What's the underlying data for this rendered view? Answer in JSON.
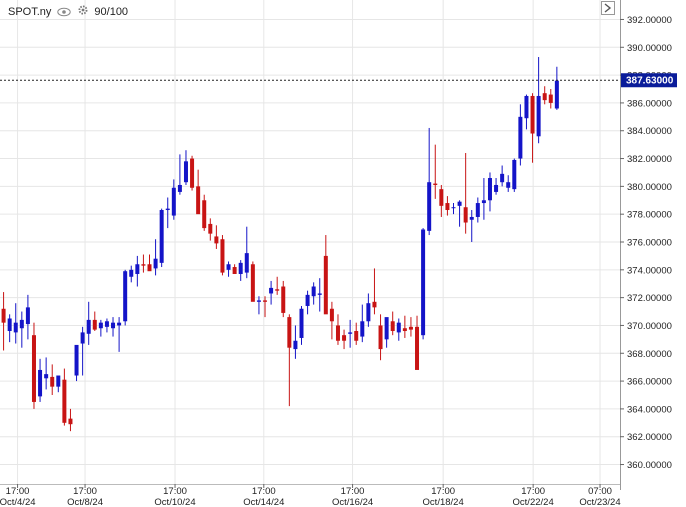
{
  "header": {
    "symbol": "SPOT.ny",
    "visibility_icon": "eye-icon",
    "settings_icon": "gear-icon",
    "count_label": "90/100"
  },
  "price_tag": "387.63000",
  "colors": {
    "up": "#1414c8",
    "down": "#c81414",
    "grid": "#e6e6e6",
    "tag_bg": "#0a1c9a"
  },
  "chart_data": {
    "type": "candlestick",
    "ylim": [
      358.6,
      393.4
    ],
    "y_ticks": [
      "392.00000",
      "390.00000",
      "388.00000",
      "386.00000",
      "384.00000",
      "382.00000",
      "380.00000",
      "378.00000",
      "376.00000",
      "374.00000",
      "372.00000",
      "370.00000",
      "368.00000",
      "366.00000",
      "364.00000",
      "362.00000",
      "360.00000"
    ],
    "y_tick_values": [
      392,
      390,
      388,
      386,
      384,
      382,
      380,
      378,
      376,
      374,
      372,
      370,
      368,
      366,
      364,
      362,
      360
    ],
    "last_price": 387.63,
    "x_ticks": [
      {
        "line1": "17:00",
        "line2": "Oct/4/24",
        "i": 3.3
      },
      {
        "line1": "17:00",
        "line2": "Oct/8/24",
        "i": 14.4
      },
      {
        "line1": "17:00",
        "line2": "Oct/10/24",
        "i": 29.2
      },
      {
        "line1": "17:00",
        "line2": "Oct/14/24",
        "i": 43.8
      },
      {
        "line1": "17:00",
        "line2": "Oct/16/24",
        "i": 58.4
      },
      {
        "line1": "17:00",
        "line2": "Oct/18/24",
        "i": 73.3
      },
      {
        "line1": "17:00",
        "line2": "Oct/22/24",
        "i": 88.1
      },
      {
        "line1": "07:00",
        "line2": "Oct/23/24",
        "i": 99.1
      }
    ],
    "candles": [
      {
        "o": 373.8,
        "h": 373.8,
        "l": 368.5,
        "c": 370.3
      },
      {
        "o": 371.2,
        "h": 372.4,
        "l": 368.2,
        "c": 370.2
      },
      {
        "o": 369.6,
        "h": 370.8,
        "l": 368.8,
        "c": 370.5
      },
      {
        "o": 369.5,
        "h": 371.6,
        "l": 368.7,
        "c": 370.2
      },
      {
        "o": 369.8,
        "h": 371.0,
        "l": 368.4,
        "c": 370.4
      },
      {
        "o": 370.1,
        "h": 372.2,
        "l": 369.0,
        "c": 371.3
      },
      {
        "o": 369.3,
        "h": 370.2,
        "l": 364.0,
        "c": 364.5
      },
      {
        "o": 364.9,
        "h": 367.6,
        "l": 364.5,
        "c": 366.8
      },
      {
        "o": 366.2,
        "h": 367.7,
        "l": 365.4,
        "c": 366.5
      },
      {
        "o": 366.3,
        "h": 367.2,
        "l": 365.0,
        "c": 365.6
      },
      {
        "o": 365.6,
        "h": 366.2,
        "l": 365.2,
        "c": 366.4
      },
      {
        "o": 366.1,
        "h": 366.9,
        "l": 362.8,
        "c": 363.0
      },
      {
        "o": 363.3,
        "h": 364.0,
        "l": 362.4,
        "c": 362.9
      },
      {
        "o": 366.4,
        "h": 368.4,
        "l": 366.0,
        "c": 368.6
      },
      {
        "o": 368.7,
        "h": 369.9,
        "l": 366.4,
        "c": 369.5
      },
      {
        "o": 369.4,
        "h": 371.7,
        "l": 368.6,
        "c": 370.4
      },
      {
        "o": 370.4,
        "h": 371.0,
        "l": 369.6,
        "c": 369.7
      },
      {
        "o": 369.8,
        "h": 370.4,
        "l": 369.2,
        "c": 370.2
      },
      {
        "o": 369.9,
        "h": 370.5,
        "l": 369.5,
        "c": 370.3
      },
      {
        "o": 369.8,
        "h": 370.6,
        "l": 369.2,
        "c": 370.2
      },
      {
        "o": 370.0,
        "h": 370.6,
        "l": 368.1,
        "c": 370.2
      },
      {
        "o": 370.3,
        "h": 374.0,
        "l": 370.0,
        "c": 373.9
      },
      {
        "o": 373.5,
        "h": 374.3,
        "l": 373.1,
        "c": 374.0
      },
      {
        "o": 373.7,
        "h": 375.0,
        "l": 372.8,
        "c": 374.4
      },
      {
        "o": 374.4,
        "h": 375.1,
        "l": 373.8,
        "c": 374.3
      },
      {
        "o": 374.4,
        "h": 375.1,
        "l": 374.1,
        "c": 373.9
      },
      {
        "o": 374.1,
        "h": 376.2,
        "l": 373.6,
        "c": 374.8
      },
      {
        "o": 374.5,
        "h": 378.4,
        "l": 374.2,
        "c": 378.3
      },
      {
        "o": 378.3,
        "h": 379.2,
        "l": 377.0,
        "c": 378.4
      },
      {
        "o": 377.9,
        "h": 380.5,
        "l": 377.6,
        "c": 379.9
      },
      {
        "o": 379.6,
        "h": 382.3,
        "l": 379.4,
        "c": 380.1
      },
      {
        "o": 380.3,
        "h": 382.6,
        "l": 380.1,
        "c": 381.8
      },
      {
        "o": 382.0,
        "h": 382.2,
        "l": 379.7,
        "c": 379.9
      },
      {
        "o": 380.0,
        "h": 381.2,
        "l": 378.2,
        "c": 378.0
      },
      {
        "o": 379.0,
        "h": 379.4,
        "l": 376.8,
        "c": 377.0
      },
      {
        "o": 377.3,
        "h": 377.7,
        "l": 376.1,
        "c": 376.6
      },
      {
        "o": 376.4,
        "h": 377.2,
        "l": 375.5,
        "c": 375.9
      },
      {
        "o": 376.2,
        "h": 376.5,
        "l": 373.6,
        "c": 373.8
      },
      {
        "o": 374.0,
        "h": 374.6,
        "l": 373.5,
        "c": 374.4
      },
      {
        "o": 374.2,
        "h": 374.4,
        "l": 373.8,
        "c": 373.7
      },
      {
        "o": 373.7,
        "h": 374.7,
        "l": 373.2,
        "c": 374.5
      },
      {
        "o": 373.8,
        "h": 377.1,
        "l": 373.4,
        "c": 375.2
      },
      {
        "o": 374.4,
        "h": 374.6,
        "l": 373.5,
        "c": 371.7
      },
      {
        "o": 371.7,
        "h": 372.1,
        "l": 370.8,
        "c": 371.8
      },
      {
        "o": 371.8,
        "h": 372.1,
        "l": 370.6,
        "c": 371.7
      },
      {
        "o": 372.3,
        "h": 373.2,
        "l": 371.5,
        "c": 372.7
      },
      {
        "o": 372.6,
        "h": 373.5,
        "l": 372.2,
        "c": 372.5
      },
      {
        "o": 372.8,
        "h": 373.2,
        "l": 370.6,
        "c": 370.9
      },
      {
        "o": 370.6,
        "h": 370.8,
        "l": 364.2,
        "c": 368.4
      },
      {
        "o": 368.3,
        "h": 370.0,
        "l": 367.6,
        "c": 368.9
      },
      {
        "o": 369.1,
        "h": 371.4,
        "l": 368.6,
        "c": 371.2
      },
      {
        "o": 371.4,
        "h": 372.5,
        "l": 370.8,
        "c": 372.2
      },
      {
        "o": 372.1,
        "h": 373.1,
        "l": 371.5,
        "c": 372.8
      },
      {
        "o": 372.2,
        "h": 373.4,
        "l": 371.0,
        "c": 372.3
      },
      {
        "o": 375.0,
        "h": 376.5,
        "l": 371.5,
        "c": 370.8
      },
      {
        "o": 371.2,
        "h": 371.7,
        "l": 369.0,
        "c": 370.3
      },
      {
        "o": 370.0,
        "h": 370.8,
        "l": 368.6,
        "c": 368.9
      },
      {
        "o": 369.3,
        "h": 369.7,
        "l": 368.3,
        "c": 368.9
      },
      {
        "o": 369.4,
        "h": 370.4,
        "l": 368.4,
        "c": 369.5
      },
      {
        "o": 369.6,
        "h": 370.2,
        "l": 368.6,
        "c": 368.9
      },
      {
        "o": 369.2,
        "h": 371.5,
        "l": 368.8,
        "c": 370.3
      },
      {
        "o": 370.3,
        "h": 372.3,
        "l": 369.9,
        "c": 371.6
      },
      {
        "o": 371.7,
        "h": 374.1,
        "l": 370.8,
        "c": 371.3
      },
      {
        "o": 370.0,
        "h": 370.8,
        "l": 367.5,
        "c": 368.3
      },
      {
        "o": 369.0,
        "h": 370.5,
        "l": 368.4,
        "c": 370.6
      },
      {
        "o": 370.3,
        "h": 371.0,
        "l": 369.3,
        "c": 369.6
      },
      {
        "o": 369.5,
        "h": 370.5,
        "l": 368.9,
        "c": 370.2
      },
      {
        "o": 369.8,
        "h": 370.7,
        "l": 369.1,
        "c": 369.6
      },
      {
        "o": 369.9,
        "h": 370.6,
        "l": 369.2,
        "c": 369.7
      },
      {
        "o": 369.9,
        "h": 370.7,
        "l": 369.2,
        "c": 366.8
      },
      {
        "o": 369.3,
        "h": 377.0,
        "l": 369.0,
        "c": 376.9
      },
      {
        "o": 376.8,
        "h": 384.2,
        "l": 376.5,
        "c": 380.3
      },
      {
        "o": 380.2,
        "h": 383.0,
        "l": 379.1,
        "c": 380.1
      },
      {
        "o": 379.8,
        "h": 380.1,
        "l": 377.8,
        "c": 378.6
      },
      {
        "o": 378.8,
        "h": 379.3,
        "l": 377.9,
        "c": 378.3
      },
      {
        "o": 378.5,
        "h": 378.8,
        "l": 378.0,
        "c": 378.5
      },
      {
        "o": 378.6,
        "h": 379.0,
        "l": 377.1,
        "c": 378.9
      },
      {
        "o": 378.5,
        "h": 382.4,
        "l": 376.6,
        "c": 377.4
      },
      {
        "o": 377.6,
        "h": 378.3,
        "l": 376.0,
        "c": 377.8
      },
      {
        "o": 377.8,
        "h": 379.2,
        "l": 377.4,
        "c": 378.8
      },
      {
        "o": 378.8,
        "h": 380.6,
        "l": 377.6,
        "c": 379.0
      },
      {
        "o": 379.0,
        "h": 381.0,
        "l": 378.2,
        "c": 380.6
      },
      {
        "o": 379.6,
        "h": 380.6,
        "l": 379.4,
        "c": 380.1
      },
      {
        "o": 380.3,
        "h": 381.5,
        "l": 380.0,
        "c": 380.9
      },
      {
        "o": 379.9,
        "h": 380.8,
        "l": 379.6,
        "c": 380.3
      },
      {
        "o": 379.8,
        "h": 382.0,
        "l": 379.6,
        "c": 381.9
      },
      {
        "o": 382.0,
        "h": 385.9,
        "l": 381.5,
        "c": 385.0
      },
      {
        "o": 384.9,
        "h": 386.6,
        "l": 384.1,
        "c": 386.5
      },
      {
        "o": 386.5,
        "h": 386.7,
        "l": 381.7,
        "c": 383.8
      },
      {
        "o": 383.6,
        "h": 389.3,
        "l": 383.1,
        "c": 386.5
      },
      {
        "o": 386.7,
        "h": 387.2,
        "l": 385.9,
        "c": 386.2
      },
      {
        "o": 386.6,
        "h": 387.0,
        "l": 385.6,
        "c": 386.0
      },
      {
        "o": 385.6,
        "h": 388.6,
        "l": 385.5,
        "c": 387.6
      }
    ]
  }
}
